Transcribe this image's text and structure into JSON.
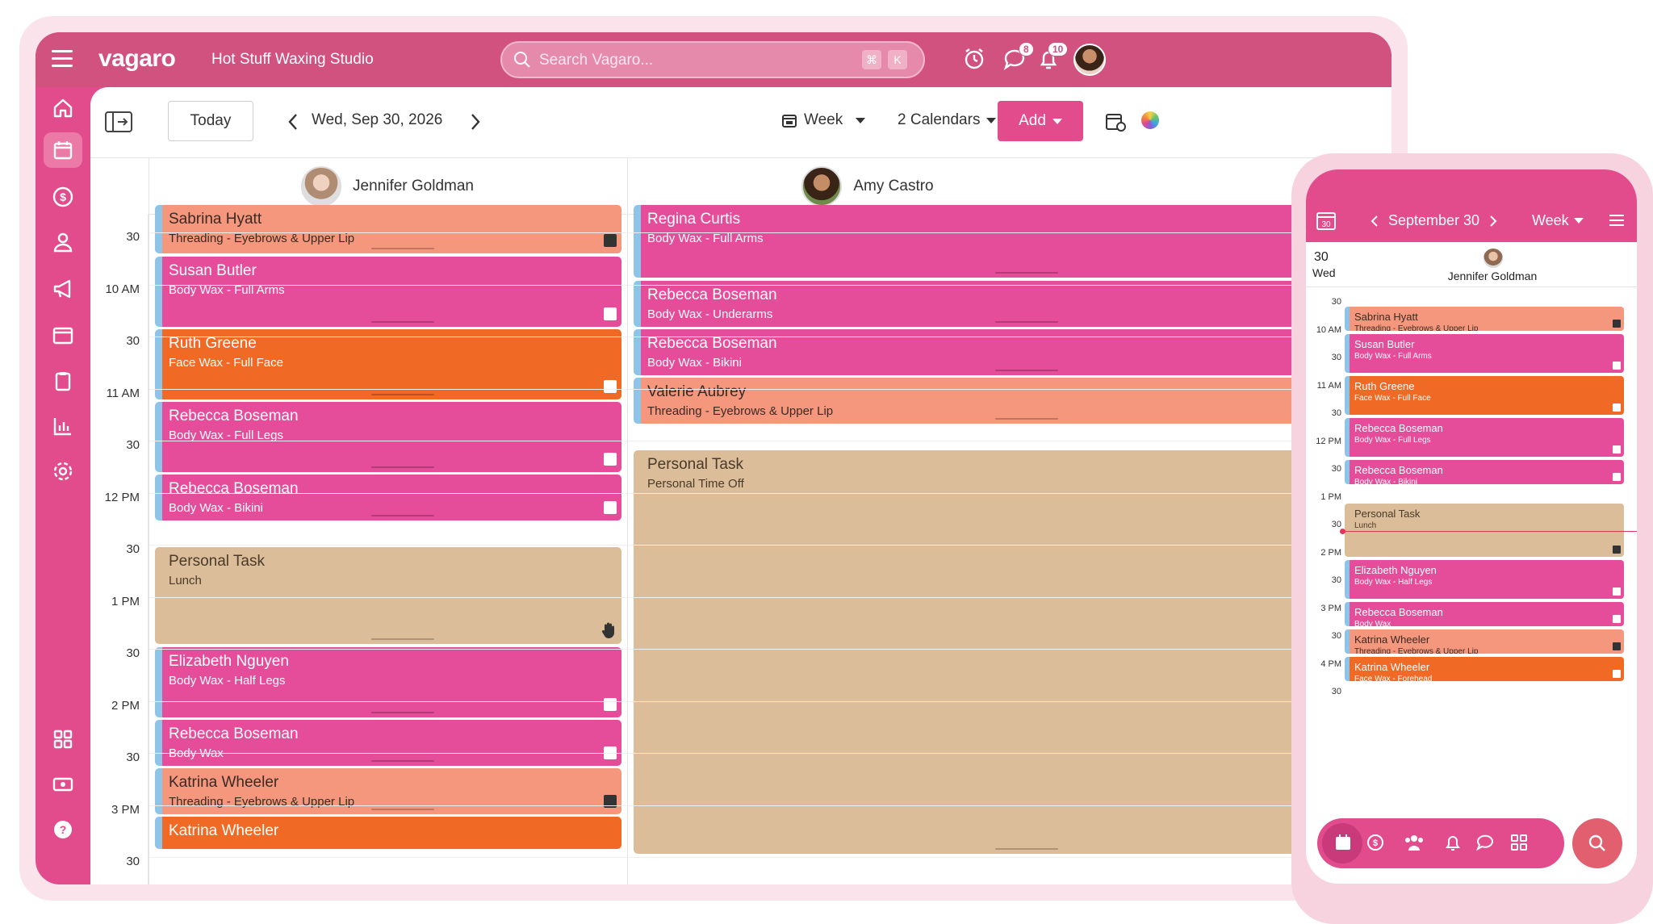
{
  "app": {
    "logo": "vagaro",
    "studio": "Hot Stuff Waxing Studio",
    "search_placeholder": "Search Vagaro...",
    "kbd_cmd": "⌘",
    "kbd_k": "K",
    "chat_badge": "8",
    "notif_badge": "10"
  },
  "toolbar": {
    "today": "Today",
    "date": "Wed, Sep 30, 2026",
    "view": "Week",
    "calendars": "2 Calendars",
    "add": "Add"
  },
  "staff": [
    {
      "name": "Jennifer Goldman"
    },
    {
      "name": "Amy Castro"
    }
  ],
  "time_labels": [
    "30",
    "10 AM",
    "30",
    "11 AM",
    "30",
    "12 PM",
    "30",
    "1 PM",
    "30",
    "2 PM",
    "30",
    "3 PM",
    "30"
  ],
  "col1": [
    {
      "name": "Sabrina Hyatt",
      "service": "Threading - Eyebrows & Upper Lip"
    },
    {
      "name": "Susan Butler",
      "service": "Body Wax - Full Arms"
    },
    {
      "name": "Ruth Greene",
      "service": "Face Wax - Full Face"
    },
    {
      "name": "Rebecca Boseman",
      "service": "Body Wax - Full Legs"
    },
    {
      "name": "Rebecca Boseman",
      "service": "Body Wax - Bikini"
    },
    {
      "name": "Personal Task",
      "service": "Lunch"
    },
    {
      "name": "Elizabeth Nguyen",
      "service": "Body Wax - Half Legs"
    },
    {
      "name": "Rebecca Boseman",
      "service": "Body Wax"
    },
    {
      "name": "Katrina Wheeler",
      "service": "Threading - Eyebrows & Upper Lip"
    },
    {
      "name": "Katrina Wheeler",
      "service": ""
    }
  ],
  "col2": [
    {
      "name": "Regina Curtis",
      "service": "Body Wax - Full Arms"
    },
    {
      "name": "Rebecca Boseman",
      "service": "Body Wax - Underarms"
    },
    {
      "name": "Rebecca Boseman",
      "service": "Body Wax - Bikini"
    },
    {
      "name": "Valerie Aubrey",
      "service": "Threading - Eyebrows & Upper Lip"
    },
    {
      "name": "Personal Task",
      "service": "Personal Time Off"
    }
  ],
  "phone": {
    "month": "September 30",
    "view": "Week",
    "cal_day": "30",
    "day": "30",
    "dow": "Wed",
    "staff": "Jennifer Goldman",
    "time_labels": [
      "30",
      "10 AM",
      "30",
      "11 AM",
      "30",
      "12 PM",
      "30",
      "1 PM",
      "30",
      "2 PM",
      "30",
      "3 PM",
      "30",
      "4 PM",
      "30"
    ],
    "appts": [
      {
        "name": "Sabrina Hyatt",
        "service": "Threading - Eyebrows & Upper Lip"
      },
      {
        "name": "Susan Butler",
        "service": "Body Wax - Full Arms"
      },
      {
        "name": "Ruth Greene",
        "service": "Face Wax - Full Face"
      },
      {
        "name": "Rebecca Boseman",
        "service": "Body Wax - Full Legs"
      },
      {
        "name": "Rebecca Boseman",
        "service": "Body Wax - Bikini"
      },
      {
        "name": "Personal Task",
        "service": "Lunch"
      },
      {
        "name": "Elizabeth Nguyen",
        "service": "Body Wax - Half Legs"
      },
      {
        "name": "Rebecca Boseman",
        "service": "Body Wax"
      },
      {
        "name": "Katrina Wheeler",
        "service": "Threading - Eyebrows & Upper Lip"
      },
      {
        "name": "Katrina Wheeler",
        "service": "Face Wax - Forehead"
      }
    ]
  },
  "colors": {
    "brand": "#e24b8c",
    "pink": "#e54c9a",
    "salmon": "#f5977c",
    "orange": "#f06a25",
    "tan": "#dcbd99"
  }
}
